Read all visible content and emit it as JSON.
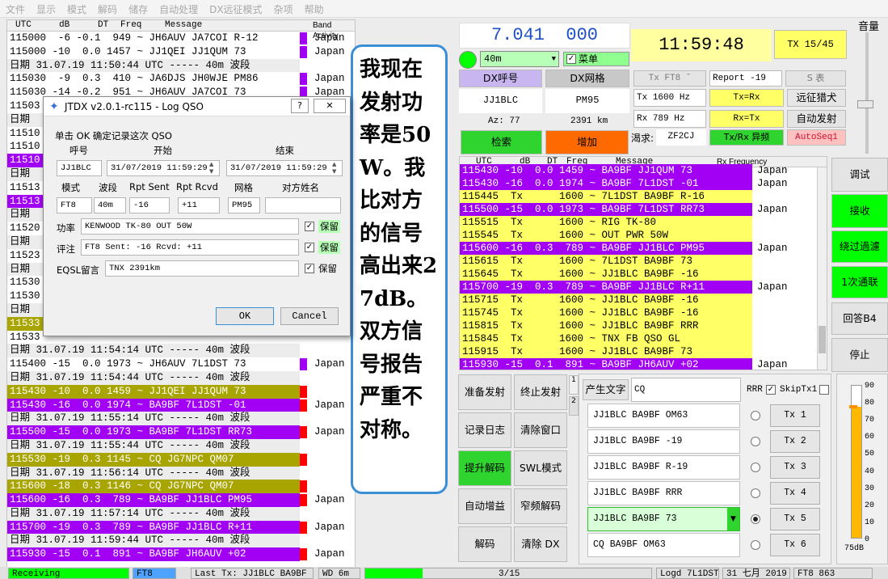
{
  "menu": [
    "文件",
    "显示",
    "模式",
    "解码",
    "储存",
    "自动处理",
    "DX远征模式",
    "杂项",
    "帮助"
  ],
  "band": {
    "headers": {
      "utc": "UTC",
      "db": "dB",
      "dt": "DT",
      "freq": "Freq",
      "message": "Message",
      "title": "Band Activity"
    },
    "lines": [
      {
        "t": "115000  -6 -0.1  949 ~ JH6AUV JA7COI R-12",
        "c": "Japan",
        "k": "plain",
        "bar": "#a100f5"
      },
      {
        "t": "115000 -10  0.0 1457 ~ JJ1QEI JJ1QUM 73",
        "c": "Japan",
        "k": "plain",
        "bar": "#a100f5"
      },
      {
        "t": "日期 31.07.19 11:50:44 UTC ----- 40m 波段",
        "c": "",
        "k": "sep"
      },
      {
        "t": "115030  -9  0.3  410 ~ JA6DJS JH0WJE PM86",
        "c": "Japan",
        "k": "plain",
        "bar": "#a100f5"
      },
      {
        "t": "115030 -14 -0.2  951 ~ JH6AUV JA7COI 73",
        "c": "Japan",
        "k": "plain",
        "bar": "#a100f5"
      },
      {
        "t": "11503",
        "c": "",
        "k": "plain"
      },
      {
        "t": "日期",
        "c": "",
        "k": "sep"
      },
      {
        "t": "11510",
        "c": "",
        "k": "plain"
      },
      {
        "t": "11510",
        "c": "",
        "k": "plain"
      },
      {
        "t": "11510",
        "c": "",
        "k": "me"
      },
      {
        "t": "日期",
        "c": "",
        "k": "sep"
      },
      {
        "t": "11513",
        "c": "",
        "k": "plain"
      },
      {
        "t": "11513",
        "c": "",
        "k": "me"
      },
      {
        "t": "日期",
        "c": "",
        "k": "sep"
      },
      {
        "t": "11520",
        "c": "",
        "k": "plain"
      },
      {
        "t": "日期",
        "c": "",
        "k": "sep"
      },
      {
        "t": "11523",
        "c": "",
        "k": "plain"
      },
      {
        "t": "日期",
        "c": "",
        "k": "sep"
      },
      {
        "t": "11530",
        "c": "",
        "k": "plain"
      },
      {
        "t": "11530",
        "c": "",
        "k": "plain"
      },
      {
        "t": "日期",
        "c": "",
        "k": "sep"
      },
      {
        "t": "11533",
        "c": "",
        "k": "cq"
      },
      {
        "t": "11533",
        "c": "",
        "k": "plain"
      },
      {
        "t": "日期 31.07.19 11:54:14 UTC ----- 40m 波段",
        "c": "",
        "k": "sep"
      },
      {
        "t": "115400 -15  0.0 1973 ~ JH6AUV 7L1DST 73",
        "c": "Japan",
        "k": "plain",
        "bar": "#a100f5"
      },
      {
        "t": "日期 31.07.19 11:54:44 UTC ----- 40m 波段",
        "c": "",
        "k": "sep"
      },
      {
        "t": "115430 -10  0.0 1459 ~ JJ1QEI JJ1QUM 73",
        "c": "Japan",
        "k": "cq",
        "bar": "#ff0000"
      },
      {
        "t": "115430 -16  0.0 1974 ~ BA9BF 7L1DST -01",
        "c": "Japan",
        "k": "me",
        "bar": "#ff0000"
      },
      {
        "t": "日期 31.07.19 11:55:14 UTC ----- 40m 波段",
        "c": "",
        "k": "sep"
      },
      {
        "t": "115500 -15  0.0 1973 ~ BA9BF 7L1DST RR73",
        "c": "Japan",
        "k": "me",
        "bar": "#ff0000"
      },
      {
        "t": "日期 31.07.19 11:55:44 UTC ----- 40m 波段",
        "c": "",
        "k": "sep"
      },
      {
        "t": "115530 -19  0.3 1145 ~ CQ JG7NPC QM07",
        "c": "Japan",
        "k": "cq",
        "bar": "#ff0000"
      },
      {
        "t": "日期 31.07.19 11:56:14 UTC ----- 40m 波段",
        "c": "",
        "k": "sep"
      },
      {
        "t": "115600 -18  0.3 1146 ~ CQ JG7NPC QM07",
        "c": "Japan",
        "k": "cq",
        "bar": "#ff0000"
      },
      {
        "t": "115600 -16  0.3  789 ~ BA9BF JJ1BLC PM95",
        "c": "Japan",
        "k": "me",
        "bar": "#ff0000"
      },
      {
        "t": "日期 31.07.19 11:57:14 UTC ----- 40m 波段",
        "c": "",
        "k": "sep"
      },
      {
        "t": "115700 -19  0.3  789 ~ BA9BF JJ1BLC R+11",
        "c": "Japan",
        "k": "me",
        "bar": "#ff0000"
      },
      {
        "t": "日期 31.07.19 11:59:44 UTC ----- 40m 波段",
        "c": "",
        "k": "sep"
      },
      {
        "t": "115930 -15  0.1  891 ~ BA9BF JH6AUV +02",
        "c": "Japan",
        "k": "me",
        "bar": "#ff0000"
      }
    ]
  },
  "note": "我现在发射功率是50W。我比对方的信号高出来27dB。双方信号报告严重不对称。",
  "dialog": {
    "title": "JTDX v2.0.1-rc115 - Log QSO",
    "help": "?",
    "close": "✕",
    "prompt": "单击 OK 确定记录这次 QSO",
    "lbl_call": "呼号",
    "lbl_start": "开始",
    "lbl_end": "结束",
    "call": "JJ1BLC",
    "start": "31/07/2019 11:59:29",
    "end": "31/07/2019 11:59:29",
    "lbl_mode": "模式",
    "lbl_band": "波段",
    "lbl_rpt_sent": "Rpt Sent",
    "lbl_rpt_rcvd": "Rpt Rcvd",
    "lbl_grid": "网格",
    "lbl_name": "对方姓名",
    "mode": "FT8",
    "band": "40m",
    "rpt_sent": "-16",
    "rpt_rcvd": "+11",
    "grid": "PM95",
    "name": "",
    "lbl_power": "功率",
    "power": "KENWOOD TK-80 OUT 50W",
    "lbl_comment": "评注",
    "comment": "FT8  Sent: -16  Rcvd: +11",
    "lbl_eqsl": "EQSL留言",
    "eqsl": "TNX      2391km",
    "keep": "保留",
    "ok": "OK",
    "cancel": "Cancel"
  },
  "top": {
    "freq": "7.041  000",
    "band": "40m",
    "menu_chk": "菜单",
    "dx_call_btn": "DX呼号",
    "dx_grid_btn": "DX网格",
    "dx_call": "JJ1BLC",
    "dx_grid": "PM95",
    "az": "Az: 77",
    "dist": "2391 km",
    "lookup": "检索",
    "add": "增加",
    "clock": "11:59:48",
    "tx_count": "TX 15/45",
    "mode_btn": "Tx  FT8  ˇ",
    "report": "Report -19",
    "s_table": "S 表",
    "tx_label": "Tx",
    "tx_freq": "1600",
    "hz": "Hz",
    "rx_label": "Rx",
    "rx_freq": "789",
    "tx_eq_rx": "Tx=Rx",
    "rx_eq_tx": "Rx=Tx",
    "hunt": "远征猎犬",
    "auto_tx": "自动发射",
    "want_lbl": "渴求:",
    "want": "ZF2CJ",
    "txrx_split": "Tx/Rx 异频",
    "autoseq": "AutoSeq1",
    "volume": "音量"
  },
  "rx": {
    "headers": {
      "utc": "UTC",
      "db": "dB",
      "dt": "DT",
      "freq": "Freq",
      "message": "Message",
      "title": "Rx Frequency"
    },
    "lines": [
      {
        "t": "115430 -10  0.0 1459 ~ BA9BF JJ1QUM 73",
        "c": "Japan",
        "k": "me"
      },
      {
        "t": "115430 -16  0.0 1974 ~ BA9BF 7L1DST -01",
        "c": "Japan",
        "k": "me"
      },
      {
        "t": "115445  Tx      1600 ~ 7L1DST BA9BF R-16",
        "c": "",
        "k": "yel"
      },
      {
        "t": "115500 -15  0.0 1973 ~ BA9BF 7L1DST RR73",
        "c": "Japan",
        "k": "me"
      },
      {
        "t": "115515  Tx      1600 ~ RIG TK-80",
        "c": "",
        "k": "yel"
      },
      {
        "t": "115545  Tx      1600 ~ OUT PWR 50W",
        "c": "",
        "k": "yel"
      },
      {
        "t": "115600 -16  0.3  789 ~ BA9BF JJ1BLC PM95",
        "c": "Japan",
        "k": "me"
      },
      {
        "t": "115615  Tx      1600 ~ 7L1DST BA9BF 73",
        "c": "",
        "k": "yel"
      },
      {
        "t": "115645  Tx      1600 ~ JJ1BLC BA9BF -16",
        "c": "",
        "k": "yel"
      },
      {
        "t": "115700 -19  0.3  789 ~ BA9BF JJ1BLC R+11",
        "c": "Japan",
        "k": "me"
      },
      {
        "t": "115715  Tx      1600 ~ JJ1BLC BA9BF -16",
        "c": "",
        "k": "yel"
      },
      {
        "t": "115745  Tx      1600 ~ JJ1BLC BA9BF -16",
        "c": "",
        "k": "yel"
      },
      {
        "t": "115815  Tx      1600 ~ JJ1BLC BA9BF RRR",
        "c": "",
        "k": "yel"
      },
      {
        "t": "115845  Tx      1600 ~ TNX FB QSO GL",
        "c": "",
        "k": "yel"
      },
      {
        "t": "115915  Tx      1600 ~ JJ1BLC BA9BF 73",
        "c": "",
        "k": "yel"
      },
      {
        "t": "115930 -15  0.1  891 ~ BA9BF JH6AUV +02",
        "c": "Japan",
        "k": "me"
      }
    ]
  },
  "side": {
    "tune": "调试",
    "monitor": "接收",
    "skip": "绕过過濾",
    "once": "1次通联",
    "reply": "回答B4",
    "stop": "停止"
  },
  "controls": {
    "enable_tx": "准备发射",
    "halt_tx": "终止发射",
    "log": "记录日志",
    "clear": "清除窗口",
    "boost": "提升解码",
    "swl": "SWL模式",
    "agc": "自动增益",
    "narrow": "窄频解码",
    "decode": "解码",
    "clear_dx": "清除 DX"
  },
  "tabs": {
    "t1": "1",
    "t2": "2"
  },
  "txpanel": {
    "gen": "产生文字",
    "cq": "CQ",
    "rrr": "RRR",
    "skip": "SkipTx1",
    "rows": [
      {
        "msg": "JJ1BLC BA9BF OM63",
        "btn": "Tx 1"
      },
      {
        "msg": "JJ1BLC BA9BF -19",
        "btn": "Tx 2"
      },
      {
        "msg": "JJ1BLC BA9BF R-19",
        "btn": "Tx 3"
      },
      {
        "msg": "JJ1BLC BA9BF RRR",
        "btn": "Tx 4"
      },
      {
        "msg": "JJ1BLC BA9BF 73",
        "btn": "Tx 5"
      },
      {
        "msg": "CQ BA9BF OM63",
        "btn": "Tx 6"
      }
    ]
  },
  "meter": {
    "ticks": [
      "90",
      "80",
      "70",
      "60",
      "50",
      "40",
      "30",
      "20",
      "10",
      "0"
    ],
    "unit": "75dB",
    "level": 0.86
  },
  "status": {
    "mode": "Receiving",
    "proto": "FT8",
    "last_tx": "Last Tx: JJ1BLC BA9BF 73",
    "wd": "WD 6m",
    "progress": "3/15",
    "logged": "Logd 7L1DST",
    "date": "31 七月 2019",
    "ft8": "FT8  863"
  },
  "colors": {
    "purple": "#a100f5",
    "olive": "#a8a400",
    "yellow": "#ffff66",
    "green": "#00ff00",
    "orange": "#ff6a00",
    "accent": "#3b8fd6"
  }
}
